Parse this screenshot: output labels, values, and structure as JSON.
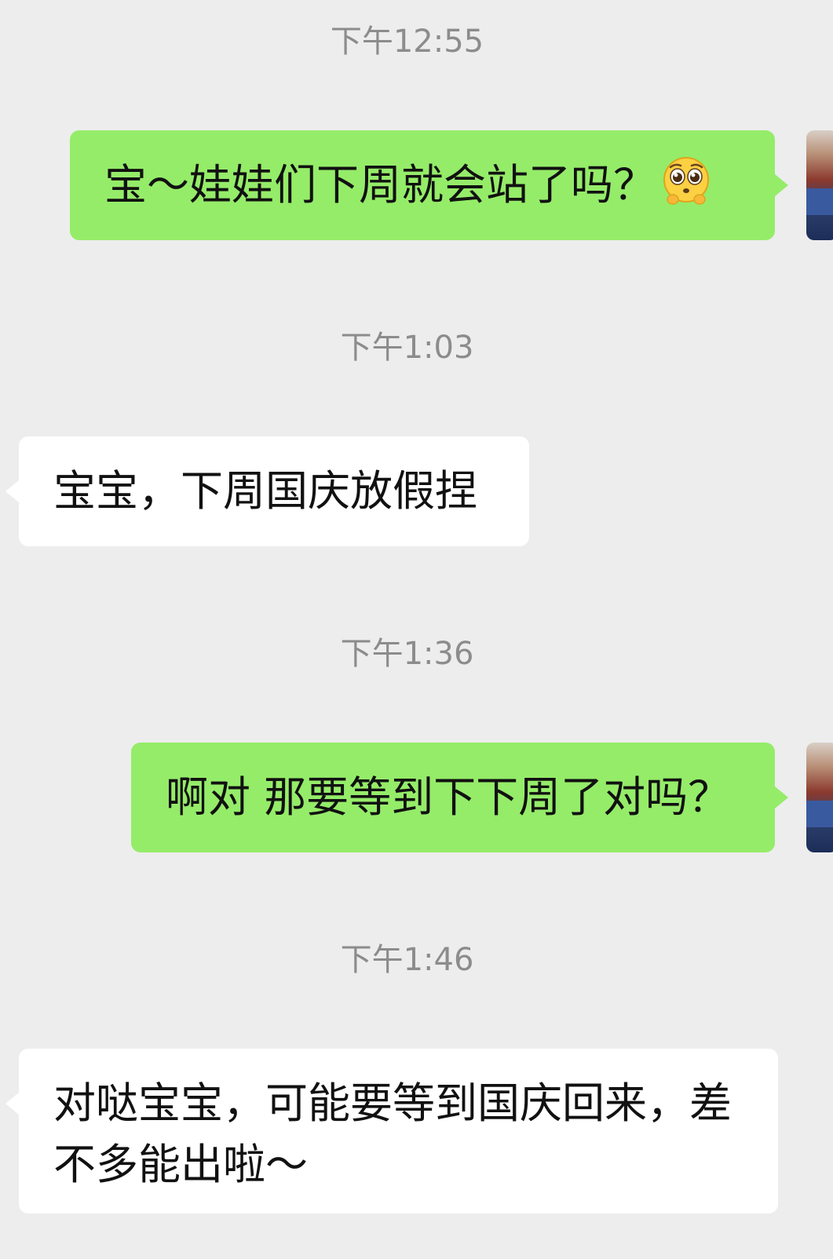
{
  "chat": {
    "messages": [
      {
        "timestamp": "下午12:55",
        "direction": "outgoing",
        "text": "宝～娃娃们下周就会站了吗？",
        "emoji": "pleading-face"
      },
      {
        "timestamp": "下午1:03",
        "direction": "incoming",
        "text": "宝宝，下周国庆放假捏"
      },
      {
        "timestamp": "下午1:36",
        "direction": "outgoing",
        "text": "啊对 那要等到下下周了对吗？"
      },
      {
        "timestamp": "下午1:46",
        "direction": "incoming",
        "text_line1": "对哒宝宝，可能要等到国庆回来，差",
        "text_line2": "不多能出啦～"
      }
    ]
  },
  "colors": {
    "background": "#ededed",
    "outgoing_bubble": "#95ec69",
    "incoming_bubble": "#ffffff",
    "timestamp_text": "#8c8c8c",
    "message_text": "#111111"
  }
}
